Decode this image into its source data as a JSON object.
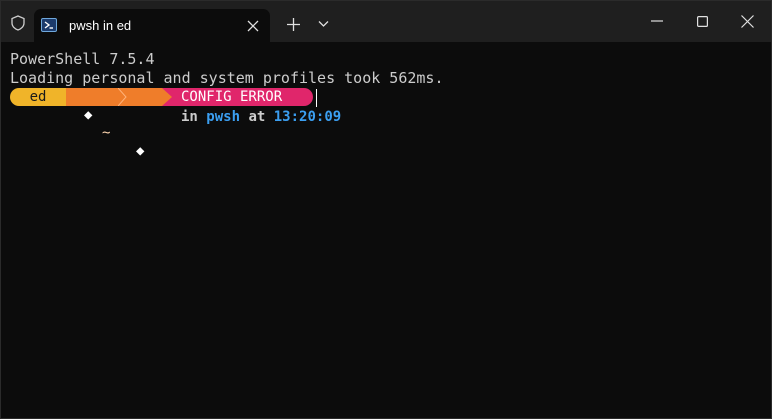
{
  "window": {
    "tab_title": "pwsh in ed",
    "new_tab_icon": "plus-icon",
    "dropdown_icon": "chevron-down-icon",
    "controls": [
      "minimize-icon",
      "maximize-icon",
      "close-icon"
    ]
  },
  "terminal": {
    "lines": [
      "PowerShell 7.5.4",
      "Loading personal and system profiles took 562ms."
    ],
    "prompt": {
      "user_segment": "ed",
      "path_segment": [
        "◆",
        "~",
        "◆"
      ],
      "error_segment": "CONFIG ERROR",
      "info_prefix": "in",
      "shell": "pwsh",
      "at": "at",
      "time": "13:20:09"
    }
  },
  "colors": {
    "user_bg": "#f0b429",
    "path_bg": "#ef7d2a",
    "error_bg": "#e0266b",
    "accent_blue": "#3b9ef0"
  }
}
